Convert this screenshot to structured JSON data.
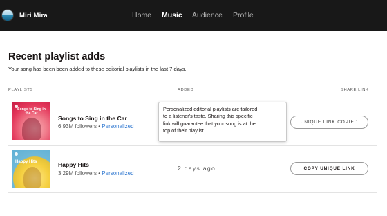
{
  "header": {
    "artist_name": "Miri Mira",
    "nav": [
      {
        "label": "Home",
        "active": false
      },
      {
        "label": "Music",
        "active": true
      },
      {
        "label": "Audience",
        "active": false
      },
      {
        "label": "Profile",
        "active": false
      }
    ]
  },
  "page": {
    "title": "Recent playlist adds",
    "subtitle": "Your song has been been added to these editorial playlists in the last 7 days."
  },
  "table": {
    "columns": {
      "playlists": "PLAYLISTS",
      "added": "ADDED",
      "share": "SHARE LINK"
    },
    "rows": [
      {
        "name": "Songs to Sing in the Car",
        "cover_text": "Songs to Sing in the Car",
        "followers": "6.93M followers",
        "separator": " • ",
        "tag": "Personalized",
        "added": "",
        "button_label": "UNIQUE LINK COPIED",
        "button_state": "copied"
      },
      {
        "name": "Happy Hits",
        "cover_text": "Happy Hits",
        "followers": "3.29M followers",
        "separator": " • ",
        "tag": "Personalized",
        "added": "2 days ago",
        "button_label": "COPY UNIQUE LINK",
        "button_state": "default"
      }
    ]
  },
  "tooltip": {
    "lines": [
      "Personalized editorial playlists are tailored",
      "to a listener's taste. Sharing this specific",
      "link will guarantee that your song is at the",
      "top of their playlist."
    ]
  },
  "colors": {
    "topbar": "#181818",
    "accent_link": "#2e77d0",
    "text": "#191414"
  }
}
